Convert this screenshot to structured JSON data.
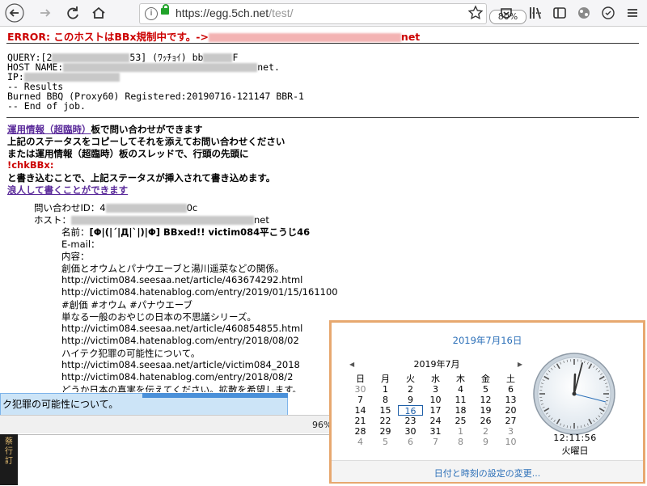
{
  "browser": {
    "url_host": "https://egg.5ch.net",
    "url_path": "/test/",
    "zoom": "80%",
    "icons": [
      "back-icon",
      "forward-icon",
      "reload-icon",
      "home-icon",
      "info-icon",
      "lock-icon",
      "more-icon",
      "pocket-icon",
      "bookmark-star-icon",
      "library-icon",
      "sidebar-icon",
      "extension-icon",
      "sync-icon",
      "menu-icon"
    ]
  },
  "error": {
    "prefix": "ERROR: このホストはBBx規制中です。->",
    "suffix": "net"
  },
  "query": {
    "line1_a": "QUERY:[2",
    "line1_b": "53] (ﾜｯﾁｮｲ) bb",
    "line1_c": "F",
    "line2_a": "HOST NAME:",
    "line2_b": "net.",
    "line3": "IP:",
    "line4": "-- Results",
    "line5": "Burned BBQ (Proxy60) Registered:20190716-121147 BBR-1",
    "line6": "-- End of job."
  },
  "info": {
    "link1": "運用情報（超臨時）",
    "line1_rest": "板で問い合わせができます",
    "line2": "上記のステータスをコピーしてそれを添えてお問い合わせください",
    "line3": "または運用情報（超臨時）板のスレッドで、行頭の先頭に",
    "line4": "!chkBBx:",
    "line5": "と書き込むことで、上記ステータスが挿入されて書き込めます。",
    "link2": "浪人して書くことができます"
  },
  "post": {
    "inquiry_id_label": "問い合わせID：4",
    "inquiry_id_tail": "0c",
    "host_label": "ホスト：",
    "host_tail": "net",
    "name_label": "名前：",
    "name_value": "[Φ|(|´|Д|`|)|Φ] BBxed!! victim084平こうじ46",
    "email_label": "E-mail：",
    "content_label": "内容：",
    "lines": [
      "創価とオウムとパナウエーブと湯川遥菜などの関係。",
      "http://victim084.seesaa.net/article/463674292.html",
      "http://victim084.hatenablog.com/entry/2019/01/15/161100",
      "#創価 #オウム #パナウエーブ",
      "単なる一般のおやじの日本の不思議シリーズ。",
      "http://victim084.seesaa.net/article/460854855.html",
      "http://victim084.hatenablog.com/entry/2018/08/02",
      "ハイテク犯罪の可能性について。",
      "http://victim084.seesaa.net/article/victim084_2018",
      "http://victim084.hatenablog.com/entry/2018/08/2",
      "どうか日本の真実を伝えてください。拡散を希望します。"
    ]
  },
  "tooltip": "ク犯罪の可能性について。",
  "status_percent": "96%",
  "taskbar_chars": "蔡\n行\n訂",
  "clock_flyout": {
    "header_date": "2019年7月16日",
    "month_label": "2019年7月",
    "weekdays": [
      "日",
      "月",
      "火",
      "水",
      "木",
      "金",
      "土"
    ],
    "days": [
      {
        "d": "30",
        "other": true
      },
      {
        "d": "1"
      },
      {
        "d": "2"
      },
      {
        "d": "3"
      },
      {
        "d": "4"
      },
      {
        "d": "5"
      },
      {
        "d": "6"
      },
      {
        "d": "7"
      },
      {
        "d": "8"
      },
      {
        "d": "9"
      },
      {
        "d": "10"
      },
      {
        "d": "11"
      },
      {
        "d": "12"
      },
      {
        "d": "13"
      },
      {
        "d": "14"
      },
      {
        "d": "15"
      },
      {
        "d": "16",
        "today": true
      },
      {
        "d": "17"
      },
      {
        "d": "18"
      },
      {
        "d": "19"
      },
      {
        "d": "20"
      },
      {
        "d": "21"
      },
      {
        "d": "22"
      },
      {
        "d": "23"
      },
      {
        "d": "24"
      },
      {
        "d": "25"
      },
      {
        "d": "26"
      },
      {
        "d": "27"
      },
      {
        "d": "28"
      },
      {
        "d": "29"
      },
      {
        "d": "30"
      },
      {
        "d": "31"
      },
      {
        "d": "1",
        "other": true
      },
      {
        "d": "2",
        "other": true
      },
      {
        "d": "3",
        "other": true
      },
      {
        "d": "4",
        "other": true
      },
      {
        "d": "5",
        "other": true
      },
      {
        "d": "6",
        "other": true
      },
      {
        "d": "7",
        "other": true
      },
      {
        "d": "8",
        "other": true
      },
      {
        "d": "9",
        "other": true
      },
      {
        "d": "10",
        "other": true
      }
    ],
    "time": "12:11:56",
    "weekday": "火曜日",
    "settings_link": "日付と時刻の設定の変更..."
  }
}
